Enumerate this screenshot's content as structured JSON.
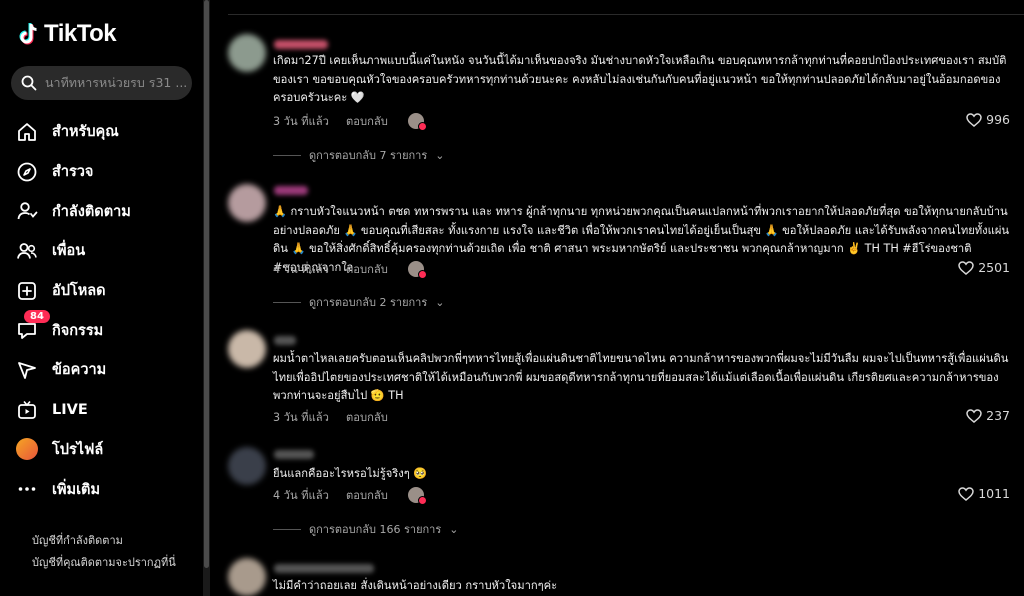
{
  "app": {
    "name": "TikTok"
  },
  "search": {
    "placeholder": "นาทีทหารหน่วยรบ ร31 ..."
  },
  "nav": [
    {
      "label": "สำหรับคุณ",
      "icon": "home-icon"
    },
    {
      "label": "สำรวจ",
      "icon": "compass-icon"
    },
    {
      "label": "กำลังติดตาม",
      "icon": "following-icon"
    },
    {
      "label": "เพื่อน",
      "icon": "friends-icon"
    },
    {
      "label": "อัปโหลด",
      "icon": "upload-icon"
    },
    {
      "label": "กิจกรรม",
      "icon": "activity-icon",
      "badge": "84"
    },
    {
      "label": "ข้อความ",
      "icon": "messages-icon"
    },
    {
      "label": "LIVE",
      "icon": "live-icon"
    },
    {
      "label": "โปรไฟล์",
      "icon": "profile-avatar"
    },
    {
      "label": "เพิ่มเติม",
      "icon": "more-icon"
    }
  ],
  "footer": {
    "link1": "บัญชีที่กำลังติดตาม",
    "link2": "บัญชีที่คุณติดตามจะปรากฏที่นี่"
  },
  "comments": [
    {
      "text": "เกิดมา27ปี เคยเห็นภาพแบบนี้แค่ในหนัง จนวันนี้ได้มาเห็นของจริง มันช่างบาดหัวใจเหลือเกิน ขอบคุณทหารกล้าทุกท่านที่คอยปกป้องประเทศของเรา สมบัติของเรา ขอขอบคุณหัวใจของครอบครัวทหารทุกท่านด้วยนะคะ คงหลับไม่ลงเช่นกันกับคนที่อยู่แนวหน้า ขอให้ทุกท่านปลอดภัยได้กลับมาอยู่ในอ้อมกอดของครอบครัวนะคะ 🤍",
      "time": "3 วัน ที่แล้ว",
      "reply": "ตอบกลับ",
      "likes": "996",
      "view_replies": "ดูการตอบกลับ 7 รายการ"
    },
    {
      "text": "🙏 กราบหัวใจแนวหน้า ตชด ทหารพราน และ ทหาร ผู้กล้าทุกนาย ทุกหน่วยพวกคุณเป็นคนแปลกหน้าที่พวกเราอยากให้ปลอดภัยที่สุด ขอให้ทุกนายกลับบ้านอย่างปลอดภัย 🙏 ขอบคุณที่เสียสละ ทั้งแรงกาย แรงใจ และชีวิต เพื่อให้พวกเราคนไทยได้อยู่เย็นเป็นสุข 🙏 ขอให้ปลอดภัย และได้รับพลังจากคนไทยทั้งแผ่นดิน 🙏 ขอให้สิ่งศักดิ์สิทธิ์คุ้มครองทุกท่านด้วยเถิด เพื่อ ชาติ ศาสนา พระมหากษัตริย์ และประชาชน พวกคุณกล้าหาญมาก ✌️ TH TH #ฮีโร่ของชาติ #ขอบคุณจากใจ",
      "time": "4 วัน ที่แล้ว",
      "reply": "ตอบกลับ",
      "likes": "2501",
      "view_replies": "ดูการตอบกลับ 2 รายการ"
    },
    {
      "text": "ผมน้ำตาไหลเลยครับตอนเห็นคลิปพวกพี่ๆทหารไทยสู้เพื่อแผ่นดินชาติไทยขนาดไหน ความกล้าหารของพวกพี่ผมจะไม่มีวันลืม ผมจะไปเป็นทหารสู้เพื่อแผ่นดินไทยเพื่ออิปไตยของประเทศชาติให้ได้เหมือนกับพวกพี่ ผมขอสดุดีทหารกล้าทุกนายที่ยอมสละได้แม้แต่เลือดเนื้อเพื่อแผ่นดิน เกียรติยศและความกล้าหารของพวกท่านจะอยู่สืบไป 🫡 TH",
      "time": "3 วัน ที่แล้ว",
      "reply": "ตอบกลับ",
      "likes": "237",
      "view_replies": ""
    },
    {
      "text": "ยืนแลกคืออะไรหรอไม่รู้จริงๆ 🥺",
      "time": "4 วัน ที่แล้ว",
      "reply": "ตอบกลับ",
      "likes": "1011",
      "view_replies": "ดูการตอบกลับ 166 รายการ"
    },
    {
      "text": "ไม่มีคำว่าถอยเลย สั่งเดินหน้าอย่างเดียว กราบหัวใจมากๆค่ะ",
      "time": "",
      "reply": "",
      "likes": "",
      "view_replies": ""
    }
  ]
}
